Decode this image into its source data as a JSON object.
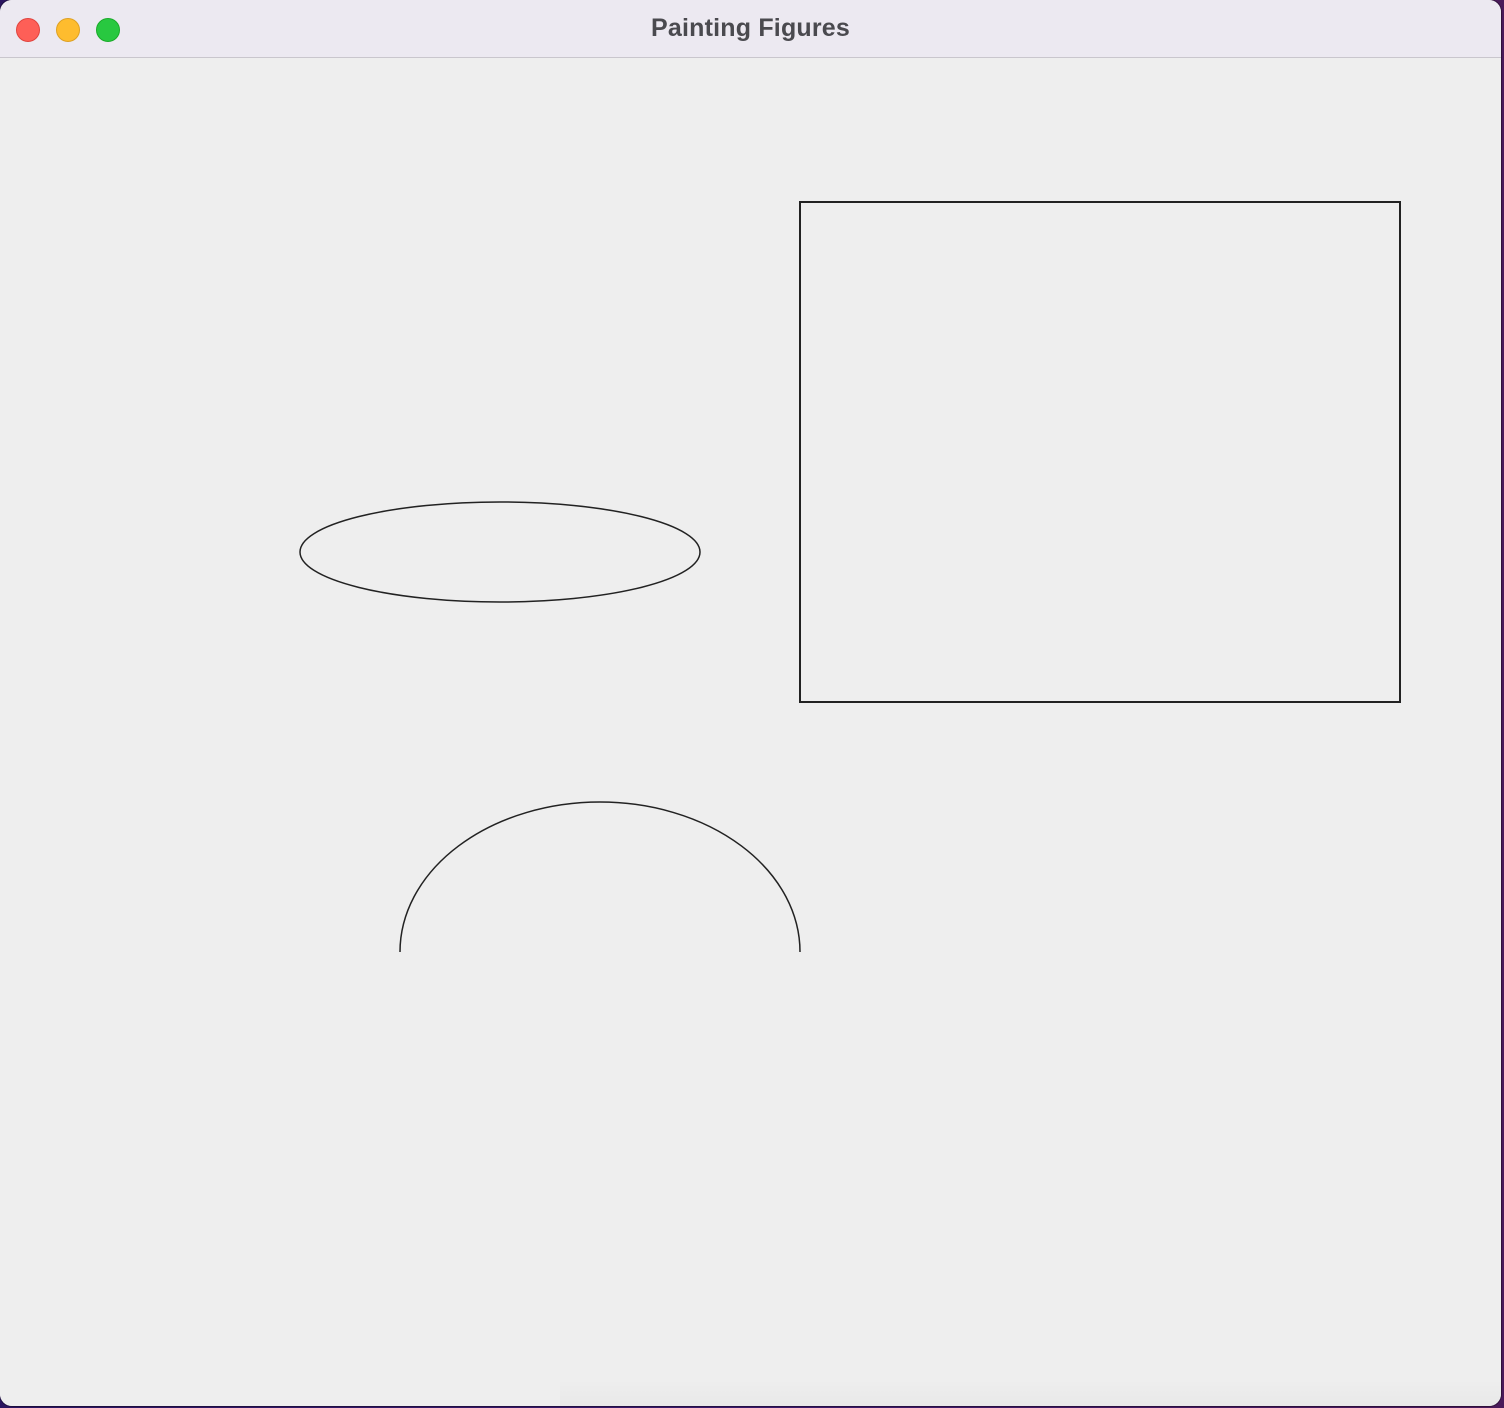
{
  "window": {
    "title": "Painting Figures",
    "controls": {
      "close": "close-button",
      "minimize": "minimize-button",
      "zoom": "zoom-button"
    }
  },
  "canvas": {
    "background": "#eeeeee",
    "stroke_color": "#222222",
    "figures": [
      "rectangle",
      "ellipse",
      "arc"
    ]
  }
}
